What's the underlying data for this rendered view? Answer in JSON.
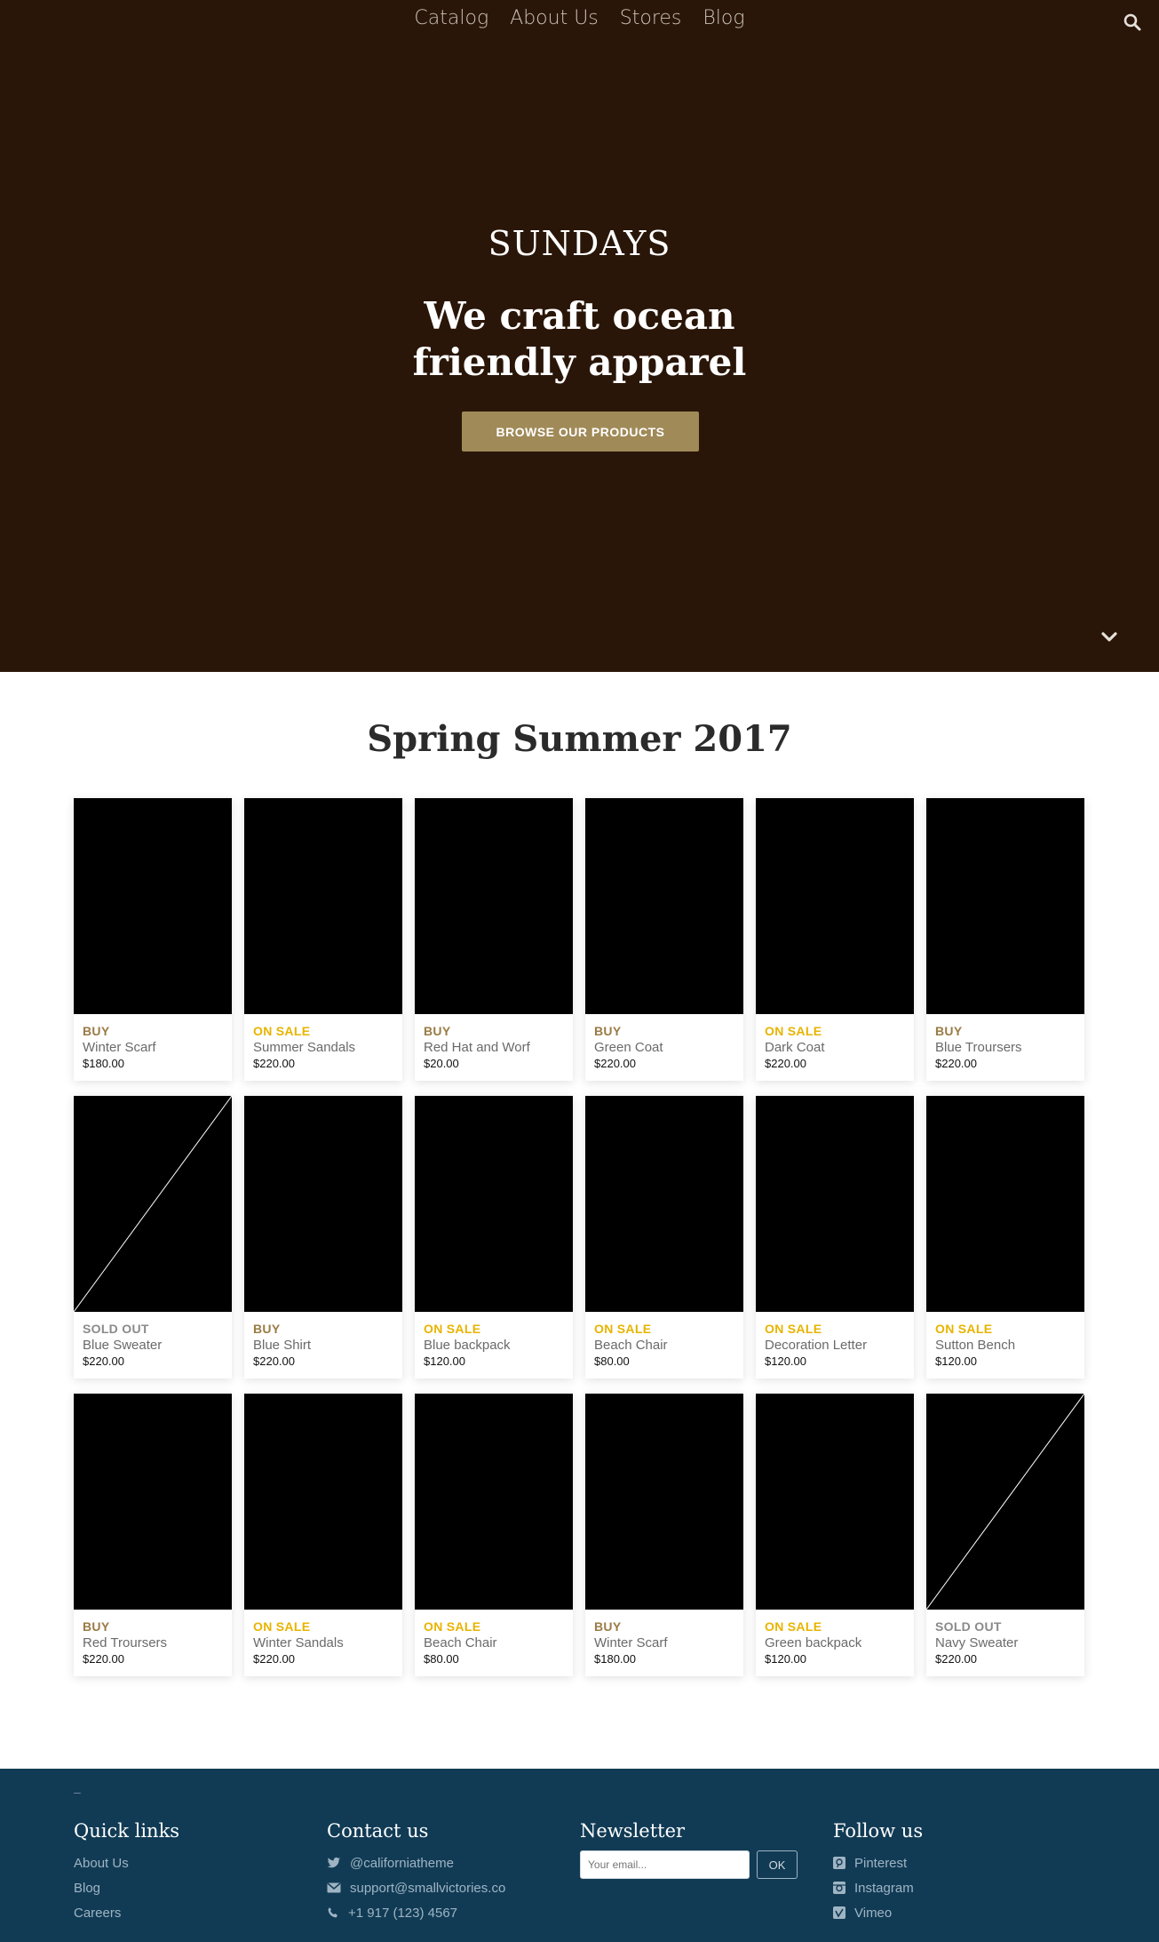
{
  "nav": {
    "items": [
      "Catalog",
      "About Us",
      "Stores",
      "Blog"
    ]
  },
  "hero": {
    "brand": "SUNDAYS",
    "tagline_line1": "We craft ocean",
    "tagline_line2": "friendly apparel",
    "cta": "BROWSE OUR PRODUCTS",
    "background_color": "#2a1608",
    "accent_color": "#a08a58"
  },
  "collection": {
    "title": "Spring Summer 2017",
    "products": [
      {
        "status": "BUY",
        "name": "Winter Scarf",
        "price": "$180.00",
        "placeholder": false
      },
      {
        "status": "ON SALE",
        "name": "Summer Sandals",
        "price": "$220.00",
        "placeholder": false
      },
      {
        "status": "BUY",
        "name": "Red Hat and Worf",
        "price": "$20.00",
        "placeholder": false
      },
      {
        "status": "BUY",
        "name": "Green Coat",
        "price": "$220.00",
        "placeholder": false
      },
      {
        "status": "ON SALE",
        "name": "Dark Coat",
        "price": "$220.00",
        "placeholder": false
      },
      {
        "status": "BUY",
        "name": "Blue Troursers",
        "price": "$220.00",
        "placeholder": false
      },
      {
        "status": "SOLD OUT",
        "name": "Blue Sweater",
        "price": "$220.00",
        "placeholder": true
      },
      {
        "status": "BUY",
        "name": "Blue Shirt",
        "price": "$220.00",
        "placeholder": false
      },
      {
        "status": "ON SALE",
        "name": "Blue backpack",
        "price": "$120.00",
        "placeholder": false
      },
      {
        "status": "ON SALE",
        "name": "Beach Chair",
        "price": "$80.00",
        "placeholder": false
      },
      {
        "status": "ON SALE",
        "name": "Decoration Letter",
        "price": "$120.00",
        "placeholder": false
      },
      {
        "status": "ON SALE",
        "name": "Sutton Bench",
        "price": "$120.00",
        "placeholder": false
      },
      {
        "status": "BUY",
        "name": "Red Troursers",
        "price": "$220.00",
        "placeholder": false
      },
      {
        "status": "ON SALE",
        "name": "Winter Sandals",
        "price": "$220.00",
        "placeholder": false
      },
      {
        "status": "ON SALE",
        "name": "Beach Chair",
        "price": "$80.00",
        "placeholder": false
      },
      {
        "status": "BUY",
        "name": "Winter Scarf",
        "price": "$180.00",
        "placeholder": false
      },
      {
        "status": "ON SALE",
        "name": "Green backpack",
        "price": "$120.00",
        "placeholder": false
      },
      {
        "status": "SOLD OUT",
        "name": "Navy Sweater",
        "price": "$220.00",
        "placeholder": true
      }
    ],
    "status_colors": {
      "BUY": "#9a7b45",
      "ON SALE": "#e8b400",
      "SOLD OUT": "#8a8a8a"
    }
  },
  "footer": {
    "dash": "–",
    "quick_links": {
      "title": "Quick links",
      "items": [
        "About Us",
        "Blog",
        "Careers"
      ]
    },
    "contact": {
      "title": "Contact us",
      "twitter": "@californiatheme",
      "email": "support@smallvictories.co",
      "phone": "+1 917 (123) 4567"
    },
    "newsletter": {
      "title": "Newsletter",
      "placeholder": "Your email...",
      "button": "OK"
    },
    "follow": {
      "title": "Follow us",
      "items": [
        "Pinterest",
        "Instagram",
        "Vimeo"
      ]
    },
    "background_color": "#113b55"
  }
}
